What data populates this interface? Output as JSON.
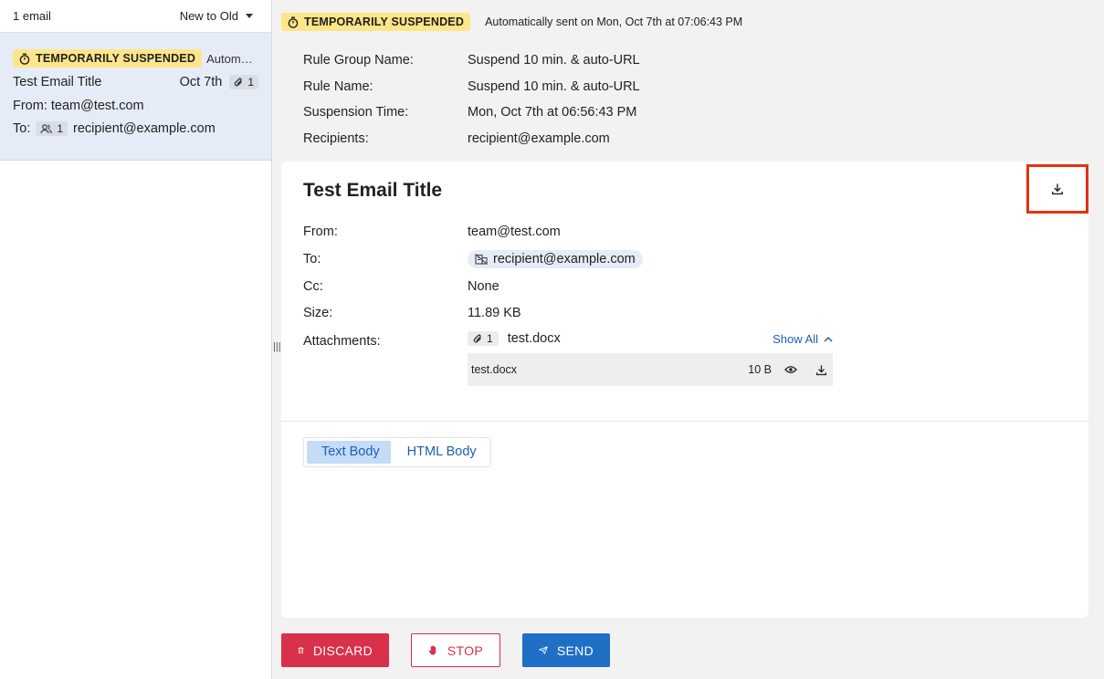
{
  "list": {
    "count_label": "1 email",
    "sort_label": "New to Old",
    "item": {
      "badge": "TEMPORARILY SUSPENDED",
      "auto_snippet": "Automati…",
      "subject": "Test Email Title",
      "date": "Oct 7th",
      "attachment_count": "1",
      "from": "From: team@test.com",
      "to_prefix": "To:",
      "recipient_count": "1",
      "to": "recipient@example.com"
    }
  },
  "detail": {
    "badge": "TEMPORARILY SUSPENDED",
    "sent_text": "Automatically sent on Mon, Oct 7th at 07:06:43 PM",
    "rule_info": [
      {
        "label": "Rule Group Name:",
        "value": "Suspend 10 min. & auto-URL"
      },
      {
        "label": "Rule Name:",
        "value": "Suspend 10 min. & auto-URL"
      },
      {
        "label": "Suspension Time:",
        "value": "Mon, Oct 7th at 06:56:43 PM"
      },
      {
        "label": "Recipients:",
        "value": "recipient@example.com"
      }
    ],
    "subject": "Test Email Title",
    "from_label": "From:",
    "from_value": "team@test.com",
    "to_label": "To:",
    "to_value": "recipient@example.com",
    "cc_label": "Cc:",
    "cc_value": "None",
    "size_label": "Size:",
    "size_value": "11.89 KB",
    "attachments_label": "Attachments:",
    "attachment_count": "1",
    "attachment_name": "test.docx",
    "show_all": "Show All",
    "attachment_row_name": "test.docx",
    "attachment_row_size": "10 B",
    "tabs": [
      "Text Body",
      "HTML Body"
    ]
  },
  "actions": {
    "discard": "DISCARD",
    "stop": "STOP",
    "send": "SEND"
  },
  "colors": {
    "badge_bg": "#fde68a",
    "selected_item_bg": "#e6ecf7",
    "discard": "#d9304b",
    "send": "#1f6fc6",
    "highlight_border": "#e53212",
    "link": "#1f5fb0"
  }
}
